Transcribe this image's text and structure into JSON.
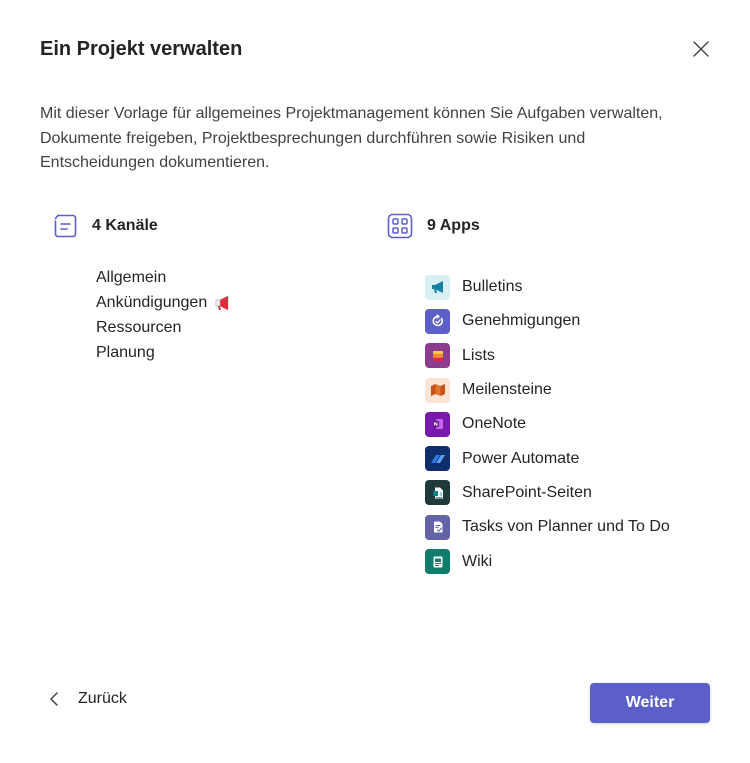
{
  "dialog": {
    "title": "Ein Projekt verwalten",
    "description": "Mit dieser Vorlage für allgemeines Projektmanagement können Sie Aufgaben verwalten, Dokumente freigeben, Projektbesprechungen durchführen sowie Risiken und Entscheidungen dokumentieren."
  },
  "channels": {
    "header": "4 Kanäle",
    "icon": "channel-list-icon",
    "items": [
      {
        "label": "Allgemein"
      },
      {
        "label": "Ankündigungen",
        "emoji": "megaphone-emoji"
      },
      {
        "label": "Ressourcen"
      },
      {
        "label": "Planung"
      }
    ]
  },
  "apps": {
    "header": "9 Apps",
    "icon": "apps-grid-icon",
    "items": [
      {
        "label": "Bulletins",
        "icon": "bulletins-icon",
        "color": "#d8f0f4"
      },
      {
        "label": "Genehmigungen",
        "icon": "approvals-icon",
        "color": "#5b5fc7"
      },
      {
        "label": "Lists",
        "icon": "lists-icon",
        "color": "#8c3d8f"
      },
      {
        "label": "Meilensteine",
        "icon": "milestones-icon",
        "color": "#fbe3d6"
      },
      {
        "label": "OneNote",
        "icon": "onenote-icon",
        "color": "#7719aa"
      },
      {
        "label": "Power Automate",
        "icon": "power-automate-icon",
        "color": "#0f2f6b"
      },
      {
        "label": "SharePoint-Seiten",
        "icon": "sharepoint-pages-icon",
        "color": "#1f3a3a"
      },
      {
        "label": "Tasks von Planner und To Do",
        "icon": "planner-tasks-icon",
        "color": "#6264a7"
      },
      {
        "label": "Wiki",
        "icon": "wiki-icon",
        "color": "#0f7c6c"
      }
    ]
  },
  "footer": {
    "back_label": "Zurück",
    "next_label": "Weiter"
  },
  "colors": {
    "accent": "#5b5fc7",
    "text": "#242424"
  }
}
